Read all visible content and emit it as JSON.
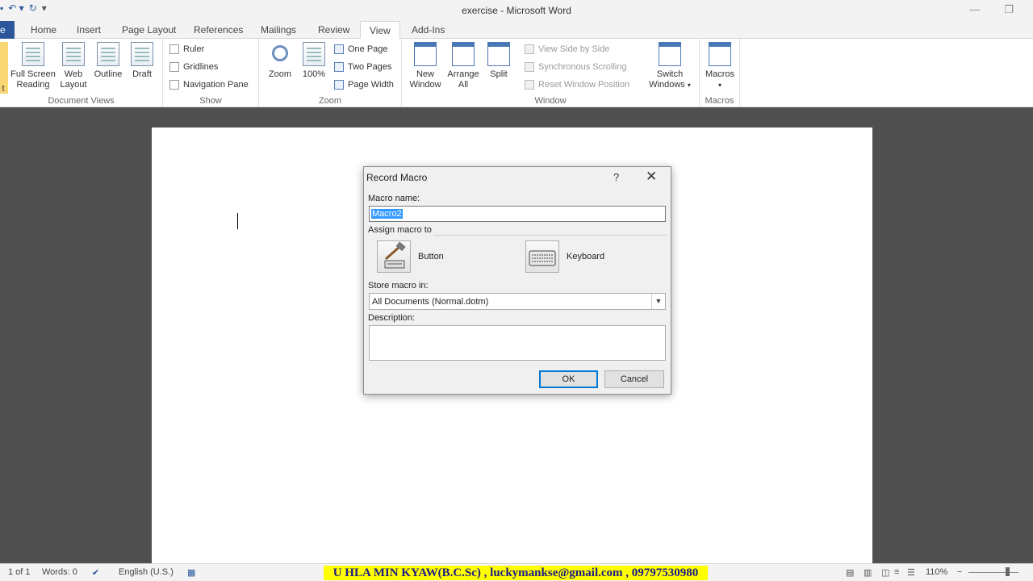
{
  "window": {
    "title": "exercise - Microsoft Word"
  },
  "qat": {
    "save_icon": "save-icon",
    "undo_icon": "undo-icon",
    "redo_icon": "redo-icon",
    "customize_icon": "customize-icon"
  },
  "tabs": [
    "Home",
    "Insert",
    "Page Layout",
    "References",
    "Mailings",
    "Review",
    "View",
    "Add-Ins"
  ],
  "active_tab": "View",
  "ribbon": {
    "document_views": {
      "label": "Document Views",
      "partial_label": "t",
      "buttons": [
        {
          "line1": "Full Screen",
          "line2": "Reading"
        },
        {
          "line1": "Web",
          "line2": "Layout"
        },
        {
          "line1": "Outline",
          "line2": ""
        },
        {
          "line1": "Draft",
          "line2": ""
        }
      ]
    },
    "show": {
      "label": "Show",
      "items": [
        "Ruler",
        "Gridlines",
        "Navigation Pane"
      ]
    },
    "zoom": {
      "label": "Zoom",
      "zoom_btn": "Zoom",
      "percent_btn": "100%",
      "items": [
        "One Page",
        "Two Pages",
        "Page Width"
      ]
    },
    "window": {
      "label": "Window",
      "new_window": {
        "line1": "New",
        "line2": "Window"
      },
      "arrange_all": {
        "line1": "Arrange",
        "line2": "All"
      },
      "split": "Split",
      "disabled_items": [
        "View Side by Side",
        "Synchronous Scrolling",
        "Reset Window Position"
      ],
      "switch_windows": {
        "line1": "Switch",
        "line2": "Windows"
      }
    },
    "macros": {
      "label": "Macros",
      "button": "Macros"
    }
  },
  "dialog": {
    "title": "Record Macro",
    "help": "?",
    "close": "✕",
    "macro_name_label": "Macro name:",
    "macro_name_value": "Macro2",
    "assign_label": "Assign macro to",
    "button_label": "Button",
    "keyboard_label": "Keyboard",
    "store_label": "Store macro in:",
    "store_value": "All Documents (Normal.dotm)",
    "description_label": "Description:",
    "description_value": "",
    "ok": "OK",
    "cancel": "Cancel"
  },
  "statusbar": {
    "page": "1 of 1",
    "words": "Words: 0",
    "language": "English (U.S.)",
    "banner": "U HLA MIN KYAW(B.C.Sc) , luckymankse@gmail.com , 09797530980",
    "zoom": "110%",
    "zoom_out": "−"
  },
  "colors": {
    "accent": "#2b579a",
    "workspace": "#4f4f4f",
    "banner_bg": "#ffff00"
  }
}
